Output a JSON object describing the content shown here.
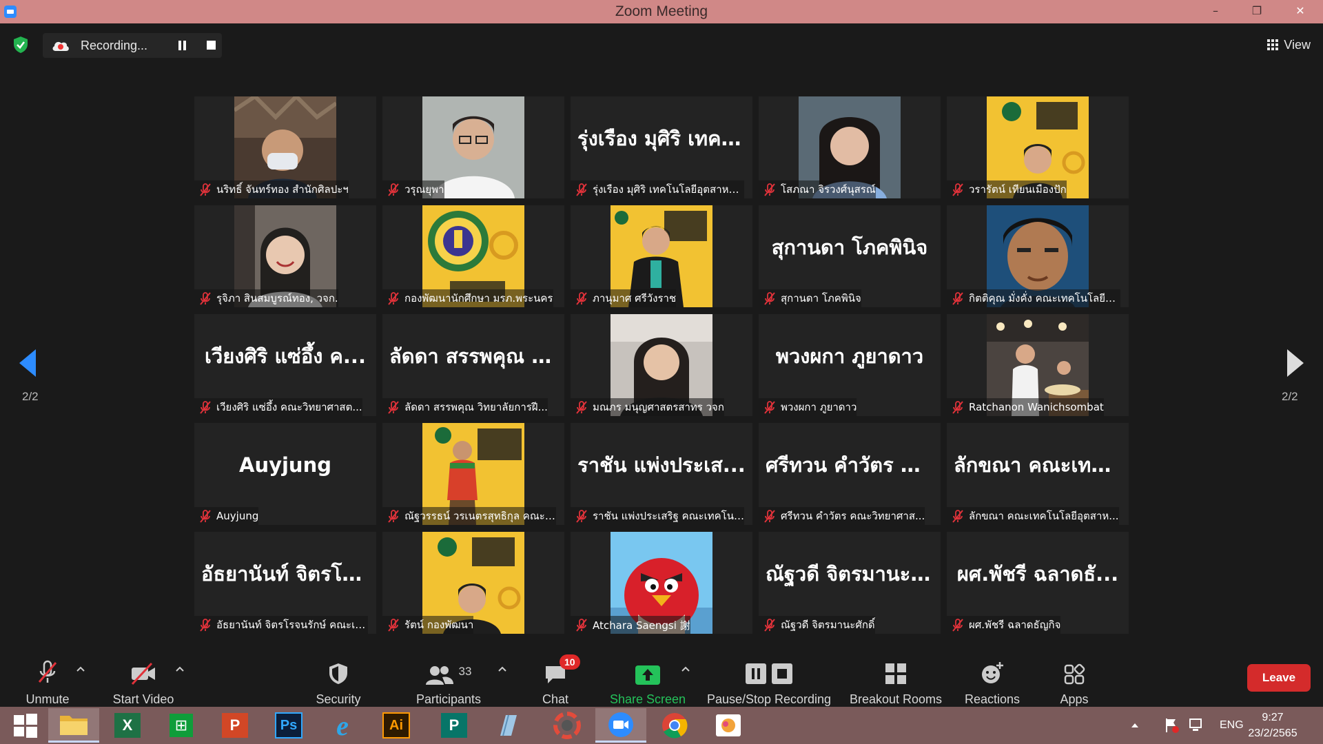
{
  "window": {
    "title": "Zoom Meeting",
    "minimize": "–",
    "restore": "❐",
    "close": "✕"
  },
  "recording": {
    "label": "Recording..."
  },
  "view_button": {
    "label": "View"
  },
  "pagination": {
    "left": "2/2",
    "right": "2/2"
  },
  "participants": [
    {
      "name": "นริทธิ์ จันทร์ทอง สำนักศิลปะฯ",
      "big": "",
      "photo": "photo-man-mask"
    },
    {
      "name": "วรุณยุพา",
      "big": "",
      "photo": "photo-woman-glasses"
    },
    {
      "name": "รุ่งเรือง มุศิริ เทคโนโลยีอุตสาหกร...",
      "big": "รุ่งเรือง มุศิริ เทคโ...",
      "photo": ""
    },
    {
      "name": "โสภณา จิรวงศ์นุสรณ์",
      "big": "",
      "photo": "photo-woman-portrait"
    },
    {
      "name": "วรารัตน์ เทียนเมืองปัก",
      "big": "",
      "photo": "photo-woman-poster"
    },
    {
      "name": "รุจิภา สินสมบูรณ์ทอง, วจก.",
      "big": "",
      "photo": "photo-woman-smile"
    },
    {
      "name": "กองพัฒนานักศึกษา มรภ.พระนคร",
      "big": "",
      "photo": "photo-university-logo"
    },
    {
      "name": "ภานุมาศ ศรีวังราช",
      "big": "",
      "photo": "photo-woman-suit-poster"
    },
    {
      "name": "สุกานดา โภคพินิจ",
      "big": "สุกานดา โภคพินิจ",
      "photo": ""
    },
    {
      "name": "กิตติคุณ มั่งคั่ง คณะเทคโนโลยีอุ...",
      "big": "",
      "photo": "photo-man-drawing"
    },
    {
      "name": "เวียงศิริ แซ่อึ้ง คณะวิทยาศาสต...",
      "big": "เวียงศิริ แซ่อึ้ง ค...",
      "photo": ""
    },
    {
      "name": "ลัดดา สรรพคุณ วิทยาลัยการฝี...",
      "big": "ลัดดา สรรพคุณ วิ...",
      "photo": ""
    },
    {
      "name": "มณภร มนุญศาสตรสาทร วจก",
      "big": "",
      "photo": "photo-woman-office"
    },
    {
      "name": "พวงผกา ภูยาดาว",
      "big": "พวงผกา ภูยาดาว",
      "photo": ""
    },
    {
      "name": "Ratchanon Wanichsombat",
      "big": "",
      "photo": "photo-man-restaurant"
    },
    {
      "name": "Auyjung",
      "big": "Auyjung",
      "photo": ""
    },
    {
      "name": "ณัฐวรรธน์ วรเนตรสุทธิกุล คณะเ...",
      "big": "",
      "photo": "photo-man-thai-dress"
    },
    {
      "name": "ราชัน แพ่งประเสริฐ คณะเทคโนโ...",
      "big": "ราชัน แพ่งประเส...",
      "photo": ""
    },
    {
      "name": "ศรีทวน คำวัตร คณะวิทยาศาส...",
      "big": "ศรีทวน คำวัตร ค...",
      "photo": ""
    },
    {
      "name": "ลักขณา คณะเทคโนโลยีอุตสาห...",
      "big": "ลักขณา คณะเทคโ...",
      "photo": ""
    },
    {
      "name": "อัธยานันท์ จิตรโรจนรักษ์ คณะเท...",
      "big": "อัธยานันท์ จิตรโร...",
      "photo": ""
    },
    {
      "name": "รัตน์ กองพัฒนา",
      "big": "",
      "photo": "photo-woman-poster-2"
    },
    {
      "name": "Atchara Saengsi 謝",
      "big": "",
      "photo": "photo-angry-bird"
    },
    {
      "name": "ณัฐวดี จิตรมานะศักดิ์",
      "big": "ณัฐวดี จิตรมานะศั...",
      "photo": ""
    },
    {
      "name": "ผศ.พัชรี ฉลาดธัญกิจ",
      "big": "ผศ.พัชรี ฉลาดธั...",
      "photo": ""
    }
  ],
  "toolbar": {
    "unmute": "Unmute",
    "start_video": "Start Video",
    "security": "Security",
    "participants": "Participants",
    "participants_count": "33",
    "chat": "Chat",
    "chat_badge": "10",
    "share_screen": "Share Screen",
    "pause_stop": "Pause/Stop Recording",
    "breakout": "Breakout Rooms",
    "reactions": "Reactions",
    "apps": "Apps",
    "leave": "Leave"
  },
  "colors": {
    "share_green": "#24c25a",
    "leave_red": "#d42b2b",
    "badge_red": "#e02828",
    "muted_red": "#e0323a"
  },
  "taskbar": {
    "apps": [
      "windows-start-icon",
      "file-explorer-icon",
      "excel-icon",
      "store-icon",
      "powerpoint-icon",
      "photoshop-icon",
      "internet-explorer-icon",
      "illustrator-icon",
      "publisher-icon",
      "notepad-icon",
      "photoscape-icon",
      "zoom-icon",
      "chrome-icon",
      "photos-icon"
    ],
    "excel_letter": "X",
    "store_letter": "⊞",
    "powerpoint_letter": "P",
    "photoshop_letter": "Ps",
    "ie_letter": "e",
    "illustrator_letter": "Ai",
    "publisher_letter": "P",
    "language": "ENG",
    "time": "9:27",
    "date": "23/2/2565"
  }
}
